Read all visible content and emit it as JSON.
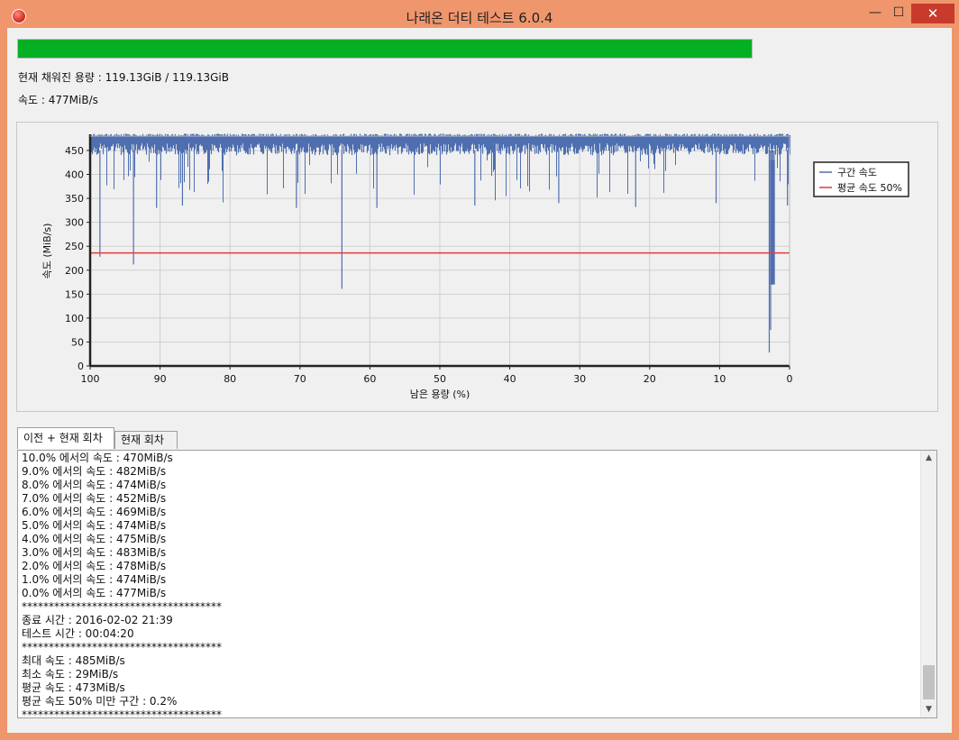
{
  "window": {
    "title": "나래온 더티 테스트 6.0.4",
    "minimize_glyph": "—",
    "maximize_glyph": "☐",
    "close_glyph": "✕",
    "app_icon": "app-logo-icon"
  },
  "progress": {
    "fraction": 1.0,
    "color": "#06b025"
  },
  "status": {
    "filled_label": "현재 채워진 용량 : 119.13GiB / 119.13GiB",
    "speed_label": "속도 : 477MiB/s"
  },
  "chart_data": {
    "type": "line",
    "xlabel": "남은 용량 (%)",
    "ylabel": "속도 (MiB/s)",
    "xlim": [
      100,
      0
    ],
    "ylim": [
      0,
      480
    ],
    "x_ticks": [
      100,
      90,
      80,
      70,
      60,
      50,
      40,
      30,
      20,
      10,
      0
    ],
    "y_ticks": [
      0,
      50,
      100,
      150,
      200,
      250,
      300,
      350,
      400,
      450
    ],
    "grid": true,
    "legend_position": "right",
    "series": [
      {
        "name": "구간 속도",
        "color": "#4f6fb0",
        "band": {
          "low": 440,
          "high": 485
        },
        "dips": [
          [
            98.6,
            228
          ],
          [
            93.8,
            212
          ],
          [
            64.0,
            161
          ],
          [
            90.5,
            330
          ],
          [
            86.8,
            335
          ],
          [
            70.5,
            330
          ],
          [
            59.0,
            330
          ],
          [
            45.0,
            335
          ],
          [
            33.0,
            340
          ],
          [
            22.0,
            332
          ],
          [
            10.5,
            340
          ],
          [
            2.9,
            28
          ],
          [
            2.7,
            75
          ],
          [
            2.6,
            170
          ],
          [
            2.4,
            172
          ],
          [
            2.2,
            292
          ],
          [
            0.3,
            335
          ]
        ]
      },
      {
        "name": "평균 속도 50%",
        "color": "#e23a3a",
        "value": 236
      }
    ]
  },
  "tabs": [
    {
      "label": "이전 + 현재 회차"
    },
    {
      "label": "현재 회차"
    }
  ],
  "log": {
    "lines": [
      "10.0% 에서의 속도 : 470MiB/s",
      "9.0% 에서의 속도 : 482MiB/s",
      "8.0% 에서의 속도 : 474MiB/s",
      "7.0% 에서의 속도 : 452MiB/s",
      "6.0% 에서의 속도 : 469MiB/s",
      "5.0% 에서의 속도 : 474MiB/s",
      "4.0% 에서의 속도 : 475MiB/s",
      "3.0% 에서의 속도 : 483MiB/s",
      "2.0% 에서의 속도 : 478MiB/s",
      "1.0% 에서의 속도 : 474MiB/s",
      "0.0% 에서의 속도 : 477MiB/s",
      "*************************************",
      "종료 시간 : 2016-02-02 21:39",
      "테스트 시간 : 00:04:20",
      "*************************************",
      "최대 속도 : 485MiB/s",
      "최소 속도 : 29MiB/s",
      "평균 속도 : 473MiB/s",
      "평균 속도 50% 미만 구간 : 0.2%",
      "*************************************"
    ]
  },
  "scrollbar": {
    "up_glyph": "▲",
    "down_glyph": "▼"
  }
}
